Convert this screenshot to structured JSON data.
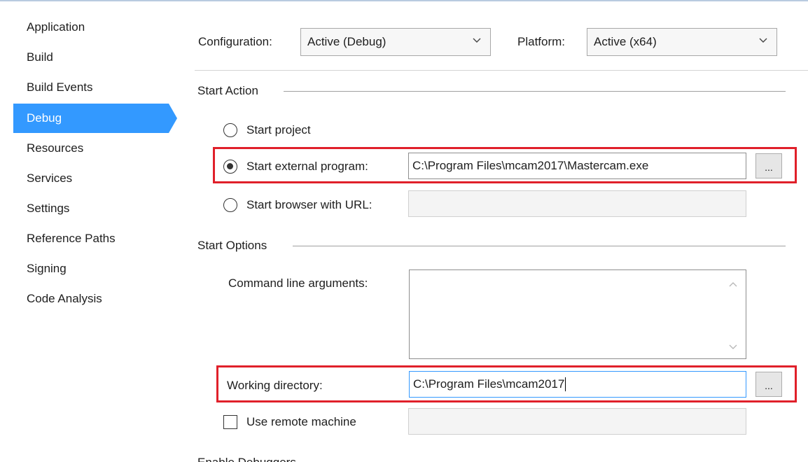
{
  "sidebar": {
    "items": [
      {
        "label": "Application"
      },
      {
        "label": "Build"
      },
      {
        "label": "Build Events"
      },
      {
        "label": "Debug"
      },
      {
        "label": "Resources"
      },
      {
        "label": "Services"
      },
      {
        "label": "Settings"
      },
      {
        "label": "Reference Paths"
      },
      {
        "label": "Signing"
      },
      {
        "label": "Code Analysis"
      }
    ],
    "active": "Debug"
  },
  "header": {
    "configuration_label": "Configuration:",
    "configuration_value": "Active (Debug)",
    "platform_label": "Platform:",
    "platform_value": "Active (x64)"
  },
  "start_action": {
    "title": "Start Action",
    "start_project_label": "Start project",
    "start_external_label": "Start external program:",
    "start_external_value": "C:\\Program Files\\mcam2017\\Mastercam.exe",
    "start_browser_label": "Start browser with URL:",
    "start_browser_value": "",
    "selected": "start_external",
    "browse_label": "..."
  },
  "start_options": {
    "title": "Start Options",
    "command_line_label": "Command line arguments:",
    "command_line_value": "",
    "working_dir_label": "Working directory:",
    "working_dir_value": "C:\\Program Files\\mcam2017",
    "browse_label": "...",
    "remote_label": "Use remote machine",
    "remote_checked": false,
    "remote_value": ""
  },
  "next_section_partial": "Enable Debuggers",
  "colors": {
    "accent": "#3399ff",
    "highlight_box": "#e0202a"
  }
}
